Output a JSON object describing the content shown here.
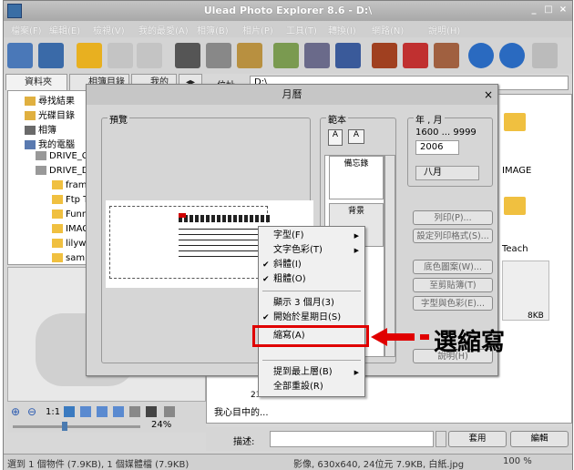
{
  "app": {
    "title": "Ulead Photo Explorer 8.6 - D:\\"
  },
  "menu": [
    "檔案(F)",
    "編輯(E)",
    "檢視(V)",
    "我的最愛(A)",
    "相簿(B)",
    "相片(P)",
    "工具(T)",
    "轉換(I)",
    "網路(N)",
    "說明(H)"
  ],
  "tabs": {
    "folders": "資料夾",
    "albums": "相簿目錄",
    "favorites": "我的"
  },
  "tree": [
    {
      "label": "尋找結果"
    },
    {
      "label": "光碟目錄"
    },
    {
      "label": "相簿"
    },
    {
      "label": "我的電腦"
    },
    {
      "label": "DRIVE_C ("
    },
    {
      "label": "DRIVE_D ("
    },
    {
      "label": "frame"
    },
    {
      "label": "Ftp To"
    },
    {
      "label": "Funnk"
    },
    {
      "label": "IMAGE"
    },
    {
      "label": "lilyweb"
    },
    {
      "label": "sampl"
    }
  ],
  "address": {
    "label": "位址:",
    "value": "D:\\"
  },
  "files": {
    "image_label": "IMAGE",
    "teach_label": "Teach",
    "size_label": "8KB",
    "partial_num": "23",
    "caption": "我心目中的..."
  },
  "zoom": {
    "value": "24%",
    "ratio": "1:1"
  },
  "desc": {
    "label": "描述:",
    "apply": "套用",
    "edit": "編輯"
  },
  "status": {
    "left": "選到 1 個物件 (7.9KB), 1 個媒體檔 (7.9KB)",
    "mid": "影像, 630x640, 24位元 7.9KB, 白紙.jpg",
    "right": "100 %"
  },
  "dialog": {
    "title": "月曆",
    "preview_label": "預覽",
    "template_label": "範本",
    "template_items": [
      "備忘錄",
      "背景"
    ],
    "year_month_label": "年 , 月",
    "year_range": "1600 ... 9999",
    "year": "2006",
    "month": "八月",
    "print": "列印(P)...",
    "print_setup": "設定列印格式(S)...",
    "bg_pattern": "底色圖案(W)...",
    "paste_to": "至剪貼簿(T)",
    "font_color": "字型與色彩(E)...",
    "help": "說明(H)"
  },
  "context_menu": [
    {
      "label": "字型(F)",
      "check": false,
      "sub": true
    },
    {
      "label": "文字色彩(T)",
      "check": false,
      "sub": true
    },
    {
      "label": "斜體(I)",
      "check": true,
      "sub": false
    },
    {
      "label": "粗體(O)",
      "check": true,
      "sub": false
    },
    {
      "label": "顯示 3 個月(3)",
      "check": false,
      "sub": false
    },
    {
      "label": "開始於星期日(S)",
      "check": true,
      "sub": false
    },
    {
      "label": "縮寫(A)",
      "check": false,
      "sub": false
    },
    {
      "label": "提到最上層(B)",
      "check": false,
      "sub": true
    },
    {
      "label": "全部重設(R)",
      "check": false,
      "sub": false
    }
  ],
  "callout": "選縮寫",
  "colors": {
    "highlight": "#e00000",
    "arrow": "#e00000"
  }
}
